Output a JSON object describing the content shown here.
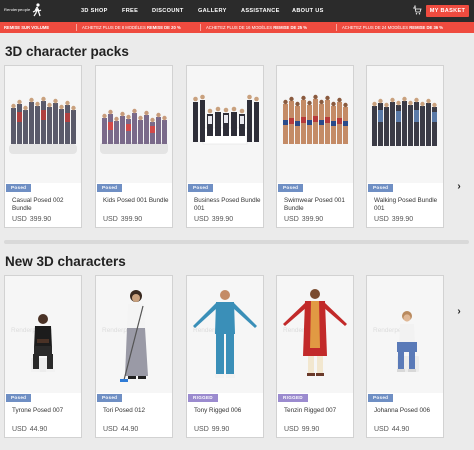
{
  "nav": {
    "logo_text": "Renderpeople",
    "items": [
      "3D SHOP",
      "FREE",
      "DISCOUNT",
      "GALLERY",
      "ASSISTANCE",
      "ABOUT US"
    ],
    "cart_count": "0",
    "basket_label": "MY BASKET"
  },
  "promo": {
    "items": [
      {
        "bold": "REMISE SUR VOLUME",
        "text": ""
      },
      {
        "text": "ACHETEZ PLUS DE 8 MODÈLES",
        "bold": "REMISE DE 20 %"
      },
      {
        "text": "ACHETEZ PLUS DE 16 MODÈLES",
        "bold": "REMISE DE 25 %"
      },
      {
        "text": "ACHETEZ PLUS DE 24 MODÈLES",
        "bold": "REMISE DE 36 %"
      }
    ]
  },
  "packs": {
    "title": "3D character packs",
    "cards": [
      {
        "badge": "Posed",
        "name": "Casual Posed 002 Bundle",
        "currency": "USD",
        "price": "399.90"
      },
      {
        "badge": "Posed",
        "name": "Kids Posed 001 Bundle",
        "currency": "USD",
        "price": "399.90"
      },
      {
        "badge": "Posed",
        "name": "Business Posed Bundle 001",
        "currency": "USD",
        "price": "399.90"
      },
      {
        "badge": "Posed",
        "name": "Swimwear Posed 001 Bundle",
        "currency": "USD",
        "price": "399.90"
      },
      {
        "badge": "Posed",
        "name": "Walking Posed Bundle 001",
        "currency": "USD",
        "price": "399.90"
      }
    ]
  },
  "characters": {
    "title": "New 3D characters",
    "cards": [
      {
        "badge": "Posed",
        "name": "Tyrone Posed 007",
        "currency": "USD",
        "price": "44.90"
      },
      {
        "badge": "Posed",
        "name": "Tori Posed 012",
        "currency": "USD",
        "price": "44.90"
      },
      {
        "badge": "RIGGED",
        "name": "Tony Rigged 006",
        "currency": "USD",
        "price": "99.90"
      },
      {
        "badge": "RIGGED",
        "name": "Tenzin Rigged 007",
        "currency": "USD",
        "price": "99.90"
      },
      {
        "badge": "Posed",
        "name": "Johanna Posed 006",
        "currency": "USD",
        "price": "44.90"
      }
    ]
  },
  "watermark": "Renderpeople",
  "arrow_glyph": "›",
  "colors": {
    "accent": "#ef4b3f",
    "nav_bg": "#2b2b2b",
    "posed": "#6f8fc4",
    "rigged": "#9b8bcf"
  }
}
